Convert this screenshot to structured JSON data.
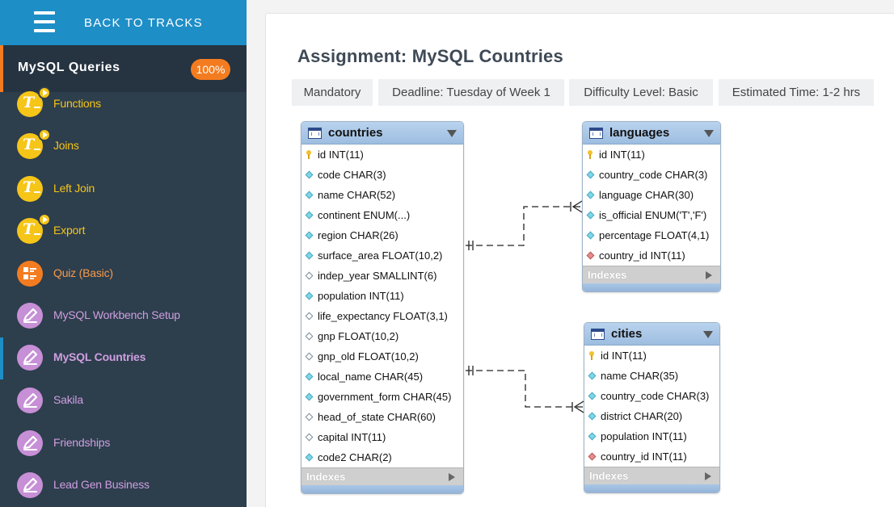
{
  "sidebar": {
    "back_label": "BACK TO TRACKS",
    "track_title": "MySQL Queries",
    "track_progress": "100%",
    "items": [
      {
        "label": "Functions",
        "kind": "video",
        "icon": "tutorial-icon"
      },
      {
        "label": "Joins",
        "kind": "video",
        "icon": "tutorial-icon"
      },
      {
        "label": "Left Join",
        "kind": "text",
        "icon": "tutorial-icon"
      },
      {
        "label": "Export",
        "kind": "video",
        "icon": "tutorial-icon"
      },
      {
        "label": "Quiz (Basic)",
        "kind": "quiz",
        "icon": "quiz-icon"
      },
      {
        "label": "MySQL Workbench Setup",
        "kind": "assignment",
        "icon": "pencil-icon"
      },
      {
        "label": "MySQL Countries",
        "kind": "assignment",
        "icon": "pencil-icon",
        "active": true
      },
      {
        "label": "Sakila",
        "kind": "assignment",
        "icon": "pencil-icon"
      },
      {
        "label": "Friendships",
        "kind": "assignment",
        "icon": "pencil-icon"
      },
      {
        "label": "Lead Gen Business",
        "kind": "assignment",
        "icon": "pencil-icon"
      }
    ]
  },
  "main": {
    "title": "Assignment: MySQL Countries",
    "chips": [
      "Mandatory",
      "Deadline: Tuesday of Week 1",
      "Difficulty Level: Basic",
      "Estimated Time: 1-2 hrs"
    ]
  },
  "erd": {
    "indexes_label": "Indexes",
    "tables": {
      "countries": {
        "name": "countries",
        "columns": [
          {
            "text": "id INT(11)",
            "marker": "key"
          },
          {
            "text": "code CHAR(3)",
            "marker": "diamond"
          },
          {
            "text": "name CHAR(52)",
            "marker": "diamond"
          },
          {
            "text": "continent ENUM(...)",
            "marker": "diamond"
          },
          {
            "text": "region CHAR(26)",
            "marker": "diamond"
          },
          {
            "text": "surface_area FLOAT(10,2)",
            "marker": "diamond"
          },
          {
            "text": "indep_year SMALLINT(6)",
            "marker": "hollow"
          },
          {
            "text": "population INT(11)",
            "marker": "diamond"
          },
          {
            "text": "life_expectancy FLOAT(3,1)",
            "marker": "hollow"
          },
          {
            "text": "gnp FLOAT(10,2)",
            "marker": "hollow"
          },
          {
            "text": "gnp_old FLOAT(10,2)",
            "marker": "hollow"
          },
          {
            "text": "local_name CHAR(45)",
            "marker": "diamond"
          },
          {
            "text": "government_form CHAR(45)",
            "marker": "diamond"
          },
          {
            "text": "head_of_state CHAR(60)",
            "marker": "hollow"
          },
          {
            "text": "capital INT(11)",
            "marker": "hollow"
          },
          {
            "text": "code2 CHAR(2)",
            "marker": "diamond"
          }
        ]
      },
      "languages": {
        "name": "languages",
        "columns": [
          {
            "text": "id INT(11)",
            "marker": "key"
          },
          {
            "text": "country_code CHAR(3)",
            "marker": "diamond"
          },
          {
            "text": "language CHAR(30)",
            "marker": "diamond"
          },
          {
            "text": "is_official ENUM('T','F')",
            "marker": "diamond"
          },
          {
            "text": "percentage FLOAT(4,1)",
            "marker": "diamond"
          },
          {
            "text": "country_id INT(11)",
            "marker": "fk"
          }
        ]
      },
      "cities": {
        "name": "cities",
        "columns": [
          {
            "text": "id INT(11)",
            "marker": "key"
          },
          {
            "text": "name CHAR(35)",
            "marker": "diamond"
          },
          {
            "text": "country_code CHAR(3)",
            "marker": "diamond"
          },
          {
            "text": "district CHAR(20)",
            "marker": "diamond"
          },
          {
            "text": "population INT(11)",
            "marker": "diamond"
          },
          {
            "text": "country_id INT(11)",
            "marker": "fk"
          }
        ]
      }
    }
  }
}
